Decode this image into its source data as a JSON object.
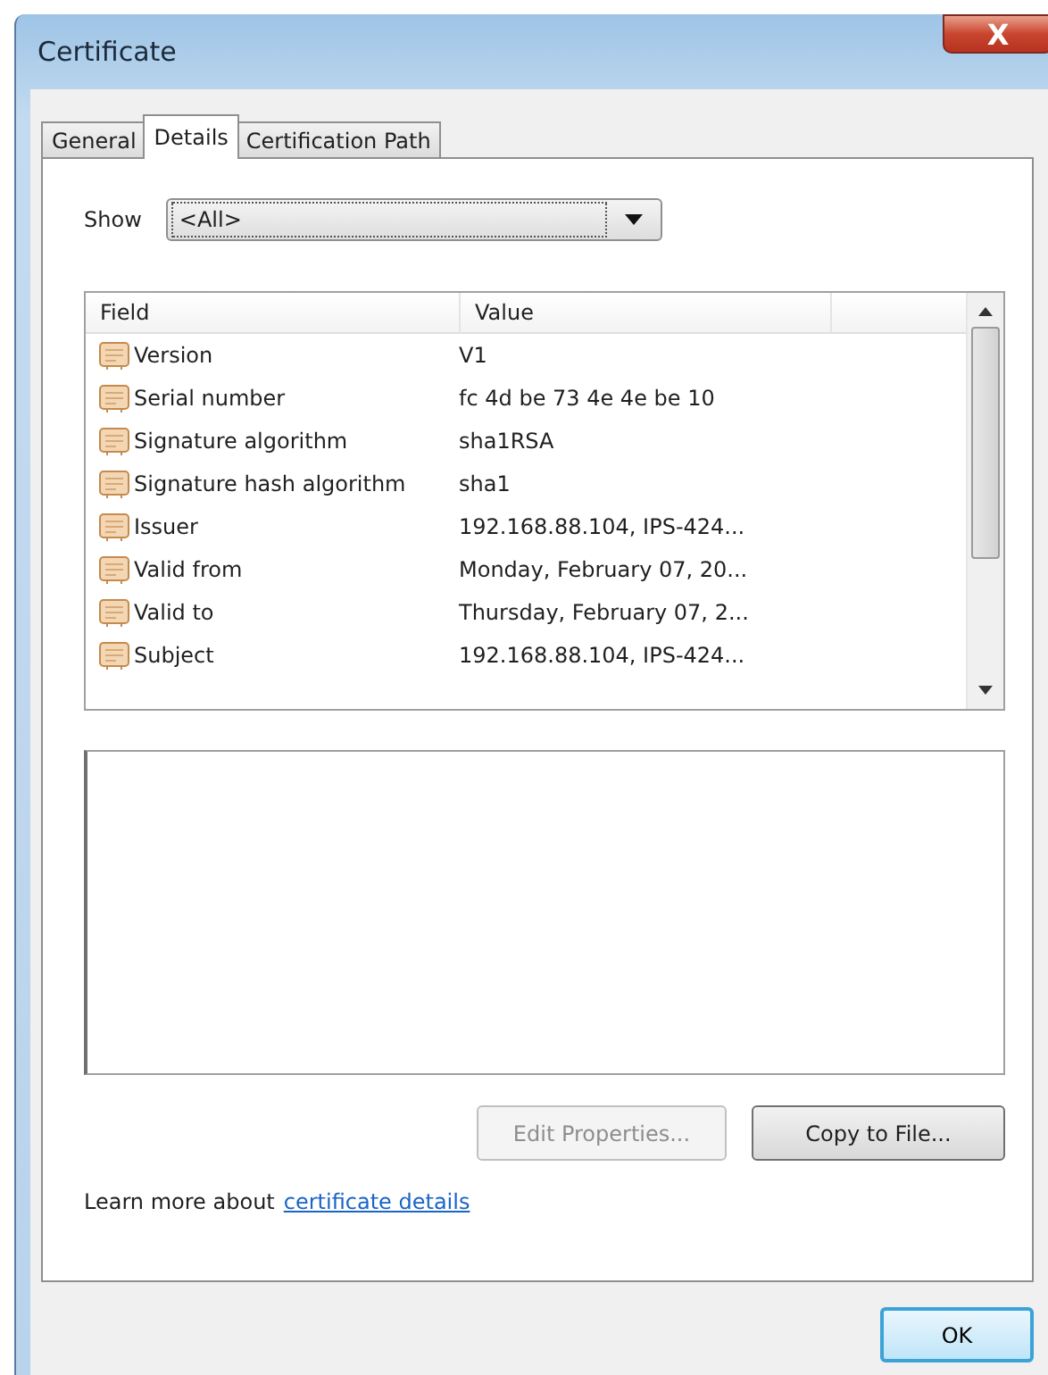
{
  "window": {
    "title": "Certificate",
    "close": "X"
  },
  "tabs": [
    {
      "label": "General",
      "selected": false
    },
    {
      "label": "Details",
      "selected": true
    },
    {
      "label": "Certification Path",
      "selected": false
    }
  ],
  "show": {
    "label": "Show",
    "value": "<All>"
  },
  "table": {
    "columns": [
      "Field",
      "Value"
    ],
    "rows": [
      {
        "field": "Version",
        "value": "V1"
      },
      {
        "field": "Serial number",
        "value": "fc 4d be 73 4e 4e be 10"
      },
      {
        "field": "Signature algorithm",
        "value": "sha1RSA"
      },
      {
        "field": "Signature hash algorithm",
        "value": "sha1"
      },
      {
        "field": "Issuer",
        "value": "192.168.88.104, IPS-424..."
      },
      {
        "field": "Valid from",
        "value": "Monday, February 07, 20..."
      },
      {
        "field": "Valid to",
        "value": "Thursday, February 07, 2..."
      },
      {
        "field": "Subject",
        "value": "192.168.88.104, IPS-424..."
      }
    ]
  },
  "buttons": [
    {
      "label": "Edit Properties...",
      "disabled": true
    },
    {
      "label": "Copy to File...",
      "disabled": false
    }
  ],
  "learn_more": {
    "text": "Learn more about",
    "link": "certificate details"
  },
  "ok": "OK"
}
